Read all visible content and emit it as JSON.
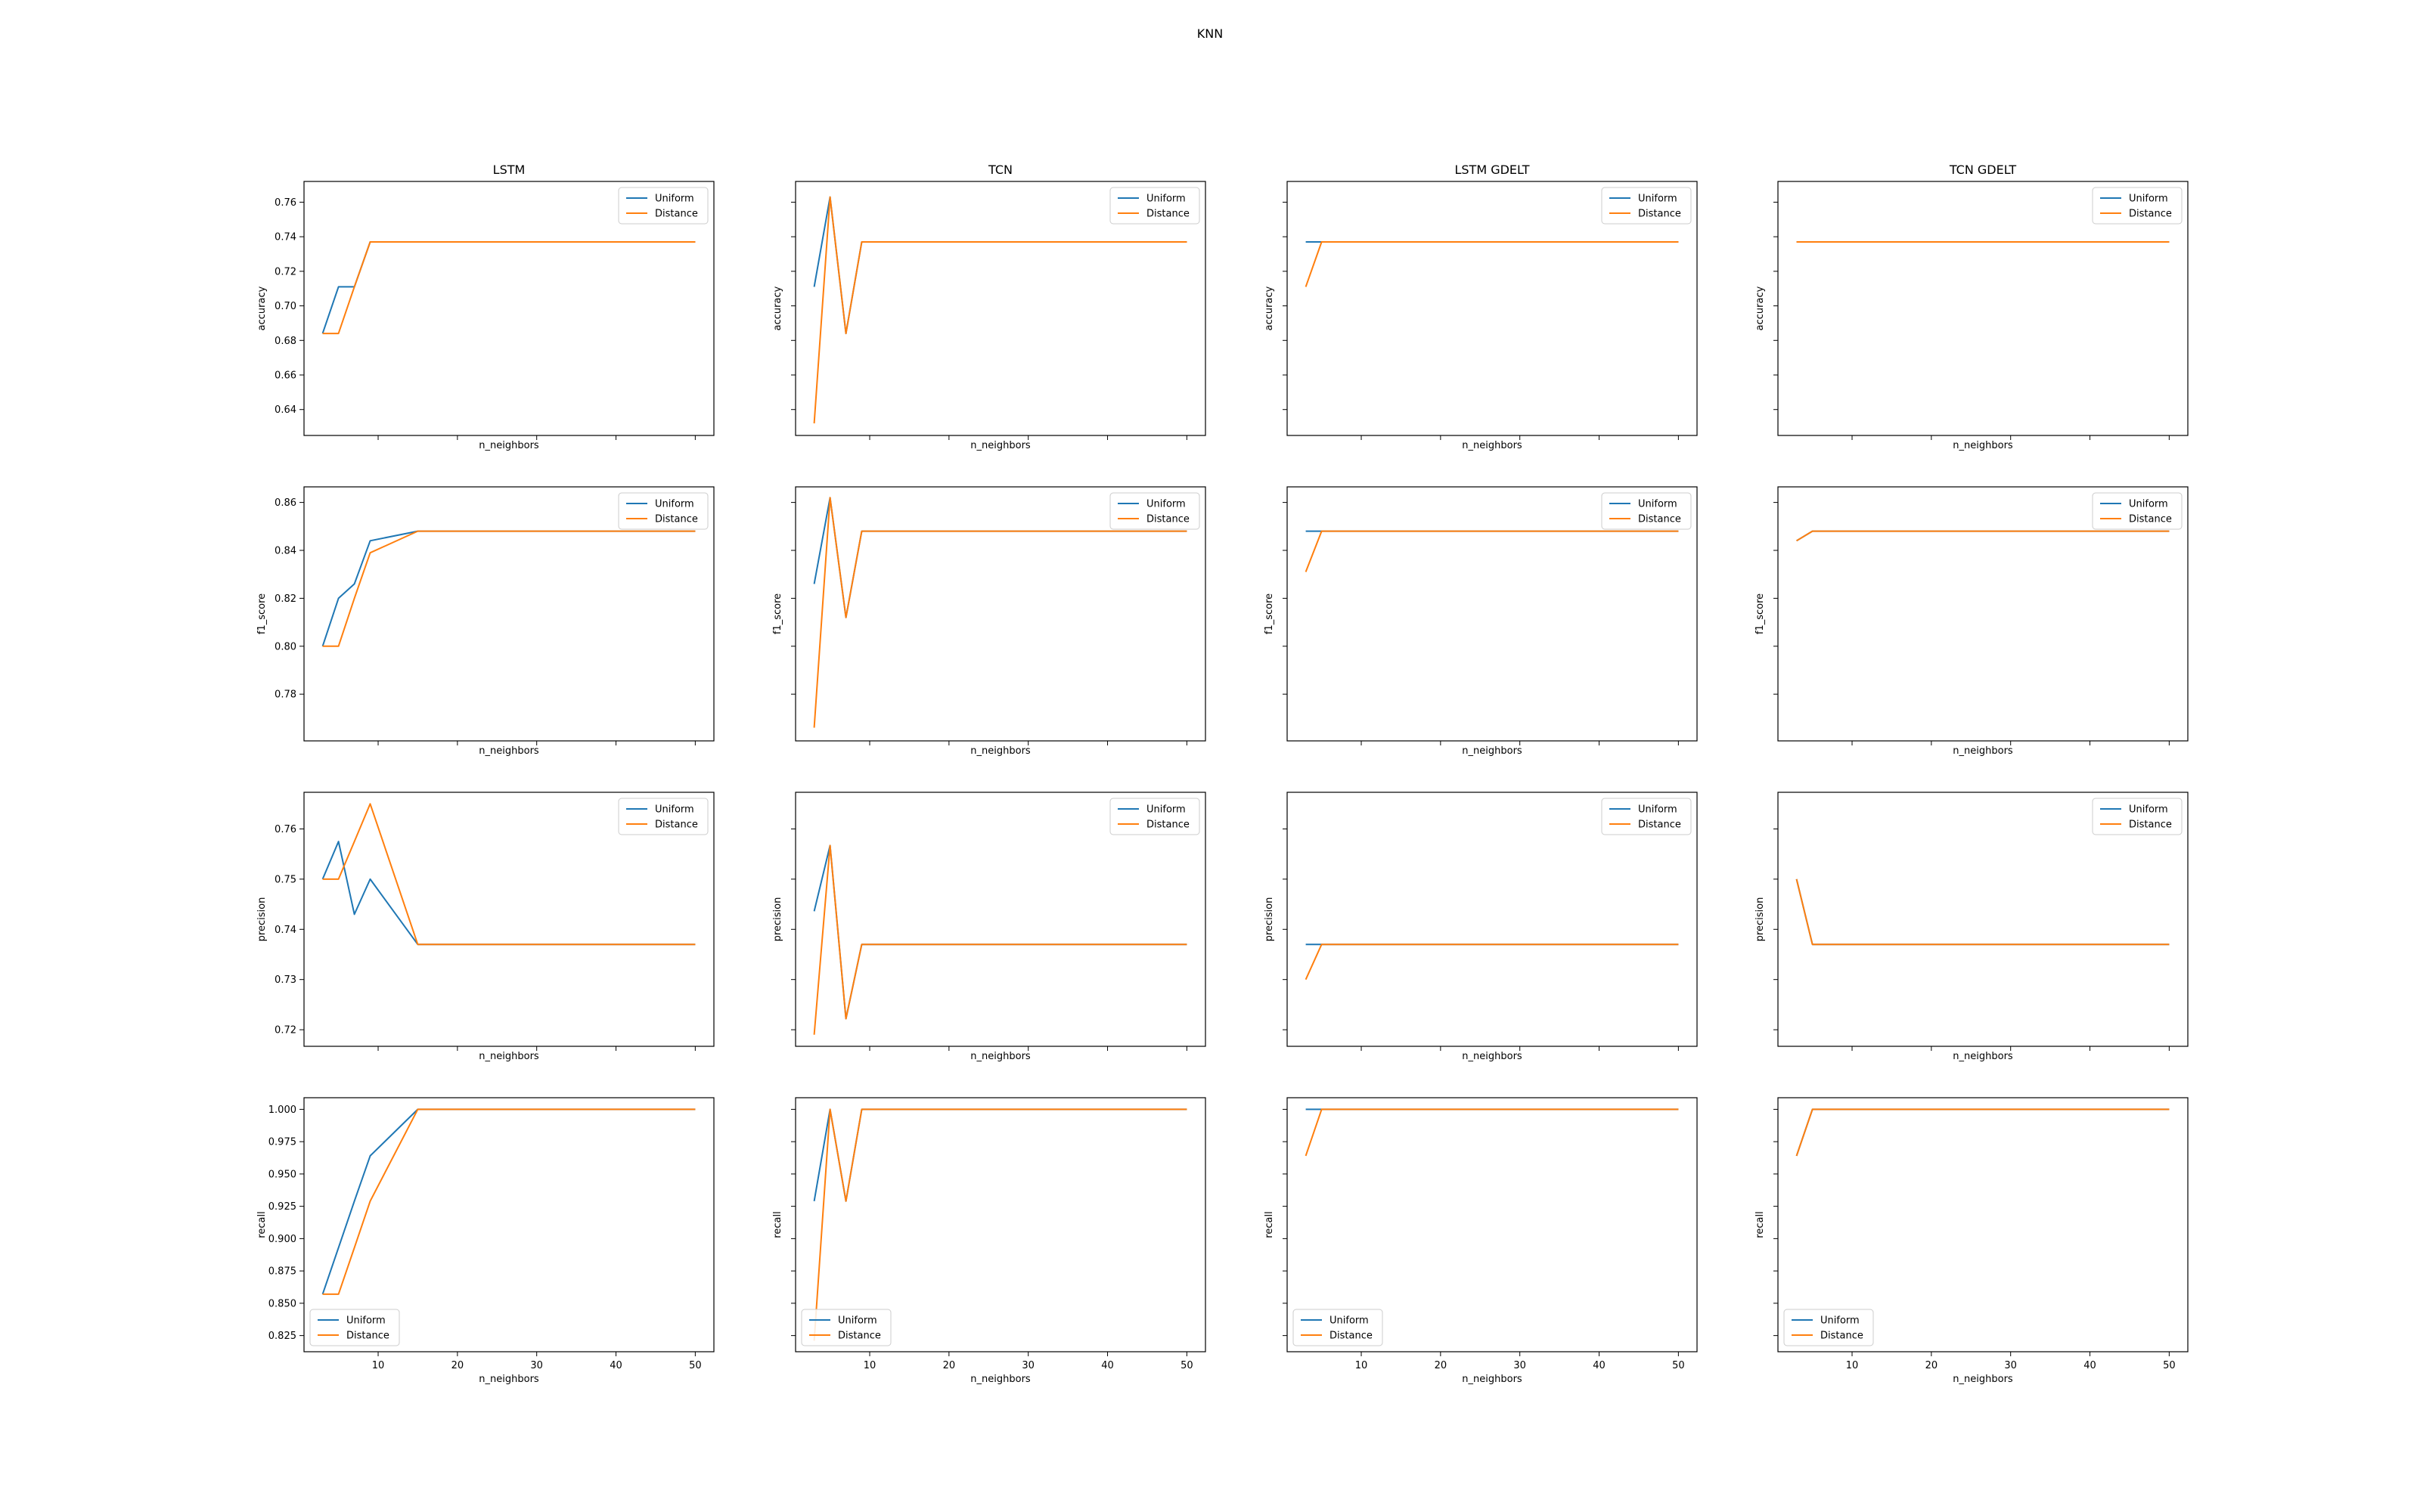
{
  "figure": {
    "suptitle": "KNN"
  },
  "colors": {
    "uniform": "#1f77b4",
    "distance": "#ff7f0e",
    "axes": "#000000",
    "legend_border": "#cccccc"
  },
  "legend_labels": [
    "Uniform",
    "Distance"
  ],
  "chart_data": {
    "type": "line",
    "x": [
      3,
      5,
      7,
      9,
      15,
      20,
      25,
      30,
      35,
      40,
      45,
      50
    ],
    "columns": [
      "LSTM",
      "TCN",
      "LSTM GDELT",
      "TCN GDELT"
    ],
    "rows": [
      {
        "ylabel": "accuracy",
        "xlabel": "n_neighbors",
        "ylim": [
          0.625,
          0.772
        ],
        "ticks": [
          "0.64",
          "0.66",
          "0.68",
          "0.70",
          "0.72",
          "0.74",
          "0.76"
        ],
        "tick_values": [
          0.64,
          0.66,
          0.68,
          0.7,
          0.72,
          0.74,
          0.76
        ],
        "legend": "top-right"
      },
      {
        "ylabel": "f1_score",
        "xlabel": "n_neighbors",
        "ylim": [
          0.7605,
          0.8665
        ],
        "ticks": [
          "0.78",
          "0.80",
          "0.82",
          "0.84",
          "0.86"
        ],
        "tick_values": [
          0.78,
          0.8,
          0.82,
          0.84,
          0.86
        ],
        "legend": "top-right"
      },
      {
        "ylabel": "precision",
        "xlabel": "n_neighbors",
        "ylim": [
          0.7167,
          0.7673
        ],
        "ticks": [
          "0.72",
          "0.73",
          "0.74",
          "0.75",
          "0.76"
        ],
        "tick_values": [
          0.72,
          0.73,
          0.74,
          0.75,
          0.76
        ],
        "legend": "top-right"
      },
      {
        "ylabel": "recall",
        "xlabel": "n_neighbors",
        "ylim": [
          0.8125,
          1.009
        ],
        "ticks": [
          "0.825",
          "0.850",
          "0.875",
          "0.900",
          "0.925",
          "0.950",
          "0.975",
          "1.000"
        ],
        "tick_values": [
          0.825,
          0.85,
          0.875,
          0.9,
          0.925,
          0.95,
          0.975,
          1.0
        ],
        "legend": "bottom-left"
      }
    ],
    "xticks": [
      "10",
      "20",
      "30",
      "40",
      "50"
    ],
    "xtick_values": [
      10,
      20,
      30,
      40,
      50
    ],
    "xlim": [
      0.65,
      52.35
    ],
    "panels": [
      [
        {
          "uniform": [
            0.684,
            0.711,
            0.711,
            0.737,
            0.737,
            0.737,
            0.737,
            0.737,
            0.737,
            0.737,
            0.737,
            0.737
          ],
          "distance": [
            0.684,
            0.684,
            0.711,
            0.737,
            0.737,
            0.737,
            0.737,
            0.737,
            0.737,
            0.737,
            0.737,
            0.737
          ]
        },
        {
          "uniform": [
            0.711,
            0.763,
            0.684,
            0.737,
            0.737,
            0.737,
            0.737,
            0.737,
            0.737,
            0.737,
            0.737,
            0.737
          ],
          "distance": [
            0.632,
            0.763,
            0.684,
            0.737,
            0.737,
            0.737,
            0.737,
            0.737,
            0.737,
            0.737,
            0.737,
            0.737
          ]
        },
        {
          "uniform": [
            0.737,
            0.737,
            0.737,
            0.737,
            0.737,
            0.737,
            0.737,
            0.737,
            0.737,
            0.737,
            0.737,
            0.737
          ],
          "distance": [
            0.711,
            0.737,
            0.737,
            0.737,
            0.737,
            0.737,
            0.737,
            0.737,
            0.737,
            0.737,
            0.737,
            0.737
          ]
        },
        {
          "uniform": [
            0.737,
            0.737,
            0.737,
            0.737,
            0.737,
            0.737,
            0.737,
            0.737,
            0.737,
            0.737,
            0.737,
            0.737
          ],
          "distance": [
            0.737,
            0.737,
            0.737,
            0.737,
            0.737,
            0.737,
            0.737,
            0.737,
            0.737,
            0.737,
            0.737,
            0.737
          ]
        }
      ],
      [
        {
          "uniform": [
            0.8,
            0.82,
            0.826,
            0.844,
            0.848,
            0.848,
            0.848,
            0.848,
            0.848,
            0.848,
            0.848,
            0.848
          ],
          "distance": [
            0.8,
            0.8,
            0.82,
            0.839,
            0.848,
            0.848,
            0.848,
            0.848,
            0.848,
            0.848,
            0.848,
            0.848
          ]
        },
        {
          "uniform": [
            0.826,
            0.862,
            0.812,
            0.848,
            0.848,
            0.848,
            0.848,
            0.848,
            0.848,
            0.848,
            0.848,
            0.848
          ],
          "distance": [
            0.766,
            0.862,
            0.812,
            0.848,
            0.848,
            0.848,
            0.848,
            0.848,
            0.848,
            0.848,
            0.848,
            0.848
          ]
        },
        {
          "uniform": [
            0.848,
            0.848,
            0.848,
            0.848,
            0.848,
            0.848,
            0.848,
            0.848,
            0.848,
            0.848,
            0.848,
            0.848
          ],
          "distance": [
            0.831,
            0.848,
            0.848,
            0.848,
            0.848,
            0.848,
            0.848,
            0.848,
            0.848,
            0.848,
            0.848,
            0.848
          ]
        },
        {
          "uniform": [
            0.844,
            0.848,
            0.848,
            0.848,
            0.848,
            0.848,
            0.848,
            0.848,
            0.848,
            0.848,
            0.848,
            0.848
          ],
          "distance": [
            0.844,
            0.848,
            0.848,
            0.848,
            0.848,
            0.848,
            0.848,
            0.848,
            0.848,
            0.848,
            0.848,
            0.848
          ]
        }
      ],
      [
        {
          "uniform": [
            0.75,
            0.7575,
            0.743,
            0.75,
            0.737,
            0.737,
            0.737,
            0.737,
            0.737,
            0.737,
            0.737,
            0.737
          ],
          "distance": [
            0.75,
            0.75,
            0.7575,
            0.765,
            0.737,
            0.737,
            0.737,
            0.737,
            0.737,
            0.737,
            0.737,
            0.737
          ]
        },
        {
          "uniform": [
            0.7436,
            0.7567,
            0.7222,
            0.737,
            0.737,
            0.737,
            0.737,
            0.737,
            0.737,
            0.737,
            0.737,
            0.737
          ],
          "distance": [
            0.719,
            0.7567,
            0.7222,
            0.737,
            0.737,
            0.737,
            0.737,
            0.737,
            0.737,
            0.737,
            0.737,
            0.737
          ]
        },
        {
          "uniform": [
            0.737,
            0.737,
            0.737,
            0.737,
            0.737,
            0.737,
            0.737,
            0.737,
            0.737,
            0.737,
            0.737,
            0.737
          ],
          "distance": [
            0.73,
            0.737,
            0.737,
            0.737,
            0.737,
            0.737,
            0.737,
            0.737,
            0.737,
            0.737,
            0.737,
            0.737
          ]
        },
        {
          "uniform": [
            0.75,
            0.737,
            0.737,
            0.737,
            0.737,
            0.737,
            0.737,
            0.737,
            0.737,
            0.737,
            0.737,
            0.737
          ],
          "distance": [
            0.75,
            0.737,
            0.737,
            0.737,
            0.737,
            0.737,
            0.737,
            0.737,
            0.737,
            0.737,
            0.737,
            0.737
          ]
        }
      ],
      [
        {
          "uniform": [
            0.857,
            0.893,
            0.929,
            0.964,
            1.0,
            1.0,
            1.0,
            1.0,
            1.0,
            1.0,
            1.0,
            1.0
          ],
          "distance": [
            0.857,
            0.857,
            0.893,
            0.929,
            1.0,
            1.0,
            1.0,
            1.0,
            1.0,
            1.0,
            1.0,
            1.0
          ]
        },
        {
          "uniform": [
            0.929,
            1.0,
            0.929,
            1.0,
            1.0,
            1.0,
            1.0,
            1.0,
            1.0,
            1.0,
            1.0,
            1.0
          ],
          "distance": [
            0.821,
            1.0,
            0.929,
            1.0,
            1.0,
            1.0,
            1.0,
            1.0,
            1.0,
            1.0,
            1.0,
            1.0
          ]
        },
        {
          "uniform": [
            1.0,
            1.0,
            1.0,
            1.0,
            1.0,
            1.0,
            1.0,
            1.0,
            1.0,
            1.0,
            1.0,
            1.0
          ],
          "distance": [
            0.964,
            1.0,
            1.0,
            1.0,
            1.0,
            1.0,
            1.0,
            1.0,
            1.0,
            1.0,
            1.0,
            1.0
          ]
        },
        {
          "uniform": [
            0.964,
            1.0,
            1.0,
            1.0,
            1.0,
            1.0,
            1.0,
            1.0,
            1.0,
            1.0,
            1.0,
            1.0
          ],
          "distance": [
            0.964,
            1.0,
            1.0,
            1.0,
            1.0,
            1.0,
            1.0,
            1.0,
            1.0,
            1.0,
            1.0,
            1.0
          ]
        }
      ]
    ]
  }
}
